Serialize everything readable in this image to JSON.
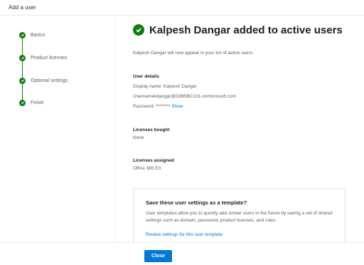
{
  "panel": {
    "title": "Add a user"
  },
  "steps": [
    {
      "label": "Basics"
    },
    {
      "label": "Product licenses"
    },
    {
      "label": "Optional settings"
    },
    {
      "label": "Finish"
    }
  ],
  "result": {
    "headline": "Kalpesh Dangar added to active users",
    "subtitle": "Kalpesh Dangar will now appear in your list of active users."
  },
  "user_details": {
    "heading": "User details",
    "display_name": "Display name: Kalpesh Dangar",
    "username": "Usernamekdangar@D365BC101.onmicrosoft.com",
    "password": "Password: ********",
    "show_link": "Show"
  },
  "licenses_bought": {
    "heading": "Licenses bought",
    "value": "None"
  },
  "licenses_assigned": {
    "heading": "Licenses assigned",
    "value": "Office 365 E3"
  },
  "template": {
    "title": "Save these user settings as a template?",
    "body": "User templates allow you to quickly add similar users in the future by saving a set of shared settings such as domain, password, product licenses, and roles.",
    "link": "Review settings for this user template"
  },
  "footer": {
    "close_label": "Close"
  },
  "colors": {
    "accent": "#0078d4",
    "success": "#107c10"
  },
  "icons": {
    "step": "checkmark-icon",
    "success": "checkmark-circle-icon"
  }
}
